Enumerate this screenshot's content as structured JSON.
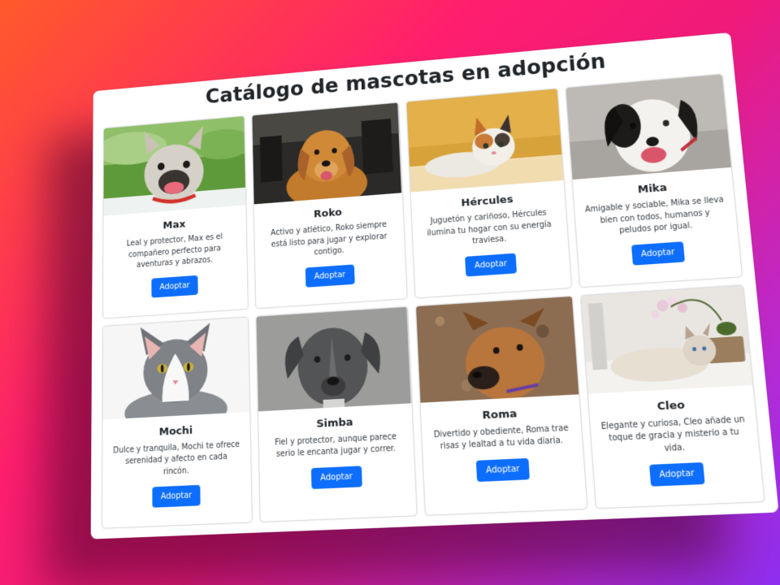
{
  "page": {
    "title": "Catálogo de mascotas en adopción",
    "accent": "#0d6efd"
  },
  "pets": [
    {
      "name": "Max",
      "description": "Leal y protector, Max es el compañero perfecto para aventuras y abrazos.",
      "button": "Adoptar"
    },
    {
      "name": "Roko",
      "description": "Activo y atlético, Roko siempre está listo para jugar y explorar contigo.",
      "button": "Adoptar"
    },
    {
      "name": "Hércules",
      "description": "Juguetón y cariñoso, Hércules ilumina tu hogar con su energía traviesa.",
      "button": "Adoptar"
    },
    {
      "name": "Mika",
      "description": "Amigable y sociable, Mika se lleva bien con todos, humanos y peludos por igual.",
      "button": "Adoptar"
    },
    {
      "name": "Mochi",
      "description": "Dulce y tranquila, Mochi te ofrece serenidad y afecto en cada rincón.",
      "button": "Adoptar"
    },
    {
      "name": "Simba",
      "description": "Fiel y protector, aunque parece serio le encanta jugar y correr.",
      "button": "Adoptar"
    },
    {
      "name": "Roma",
      "description": "Divertido y obediente, Roma trae risas y lealtad a tu vida diaria.",
      "button": "Adoptar"
    },
    {
      "name": "Cleo",
      "description": "Elegante y curiosa, Cleo añade un toque de gracia y misterio a tu vida.",
      "button": "Adoptar"
    }
  ]
}
